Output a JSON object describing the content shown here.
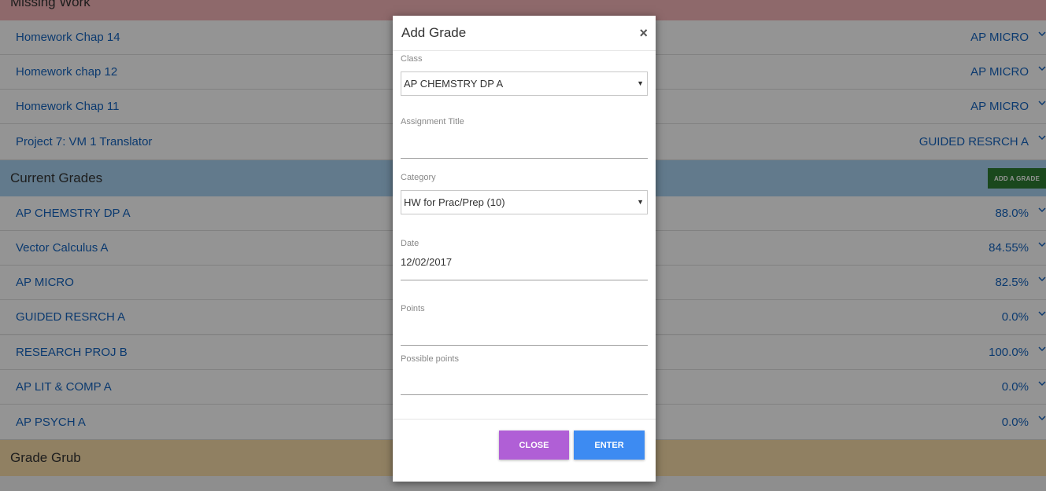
{
  "sections": {
    "missing_work": "Missing Work",
    "current_grades": "Current Grades",
    "grade_grub": "Grade Grub"
  },
  "add_grade_button": "ADD A GRADE",
  "missing_items": [
    {
      "title": "Homework Chap 14",
      "class": "AP MICRO"
    },
    {
      "title": "Homework chap 12",
      "class": "AP MICRO"
    },
    {
      "title": "Homework Chap 11",
      "class": "AP MICRO"
    },
    {
      "title": "Project 7: VM 1 Translator",
      "class": "GUIDED RESRCH A"
    }
  ],
  "grades": [
    {
      "class": "AP CHEMSTRY DP A",
      "grade": "88.0%"
    },
    {
      "class": "Vector Calculus A",
      "grade": "84.55%"
    },
    {
      "class": "AP MICRO",
      "grade": "82.5%"
    },
    {
      "class": "GUIDED RESRCH A",
      "grade": "0.0%"
    },
    {
      "class": "RESEARCH PROJ B",
      "grade": "100.0%"
    },
    {
      "class": "AP LIT & COMP A",
      "grade": "0.0%"
    },
    {
      "class": "AP PSYCH A",
      "grade": "0.0%"
    }
  ],
  "modal": {
    "title": "Add Grade",
    "close_icon": "×",
    "class_label": "Class",
    "class_value": "AP CHEMSTRY DP A",
    "assignment_label": "Assignment Title",
    "assignment_value": "",
    "category_label": "Category",
    "category_value": "HW for Prac/Prep (10)",
    "date_label": "Date",
    "date_value": "12/02/2017",
    "points_label": "Points",
    "points_value": "",
    "possible_label": "Possible points",
    "possible_value": "",
    "close_button": "CLOSE",
    "enter_button": "ENTER"
  },
  "colors": {
    "missing_header": "#f4b5b8",
    "current_header": "#a9d3f1",
    "grade_grub_header": "#f9dca9",
    "link": "#1565c0",
    "add_button": "#2e7d32",
    "close_button": "#b05fd6",
    "enter_button": "#3d8bf2"
  }
}
